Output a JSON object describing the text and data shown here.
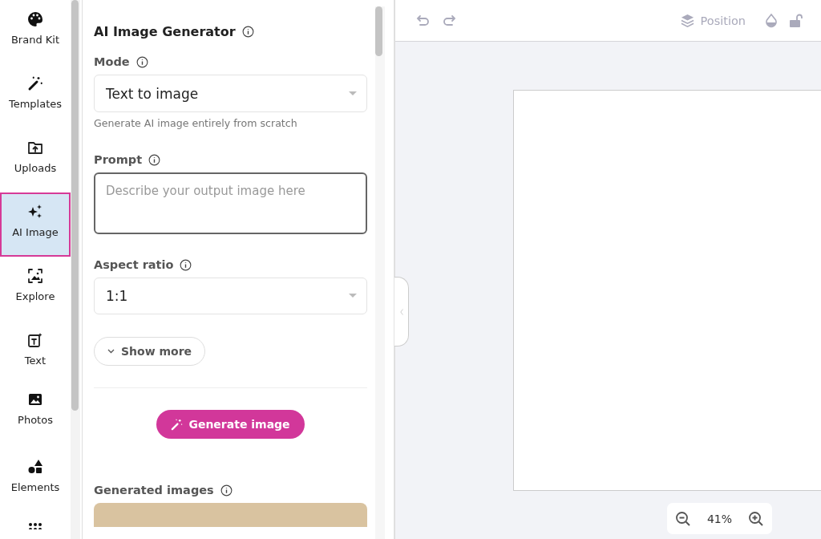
{
  "sidebar": {
    "items": [
      {
        "label": "Brand Kit",
        "selected": false
      },
      {
        "label": "Templates",
        "selected": false
      },
      {
        "label": "Uploads",
        "selected": false
      },
      {
        "label": "AI Image",
        "selected": true
      },
      {
        "label": "Explore",
        "selected": false
      },
      {
        "label": "Text",
        "selected": false
      },
      {
        "label": "Photos",
        "selected": false
      },
      {
        "label": "Elements",
        "selected": false
      }
    ]
  },
  "panel": {
    "title": "AI Image Generator",
    "mode": {
      "label": "Mode",
      "value": "Text to image",
      "hint": "Generate AI image entirely from scratch"
    },
    "prompt": {
      "label": "Prompt",
      "placeholder": "Describe your output image here"
    },
    "aspect_ratio": {
      "label": "Aspect ratio",
      "value": "1:1"
    },
    "show_more": "Show more",
    "generate_button": "Generate image",
    "generated_images": {
      "label": "Generated images"
    }
  },
  "toolbar": {
    "position": "Position"
  },
  "zoom": {
    "value": "41%"
  }
}
